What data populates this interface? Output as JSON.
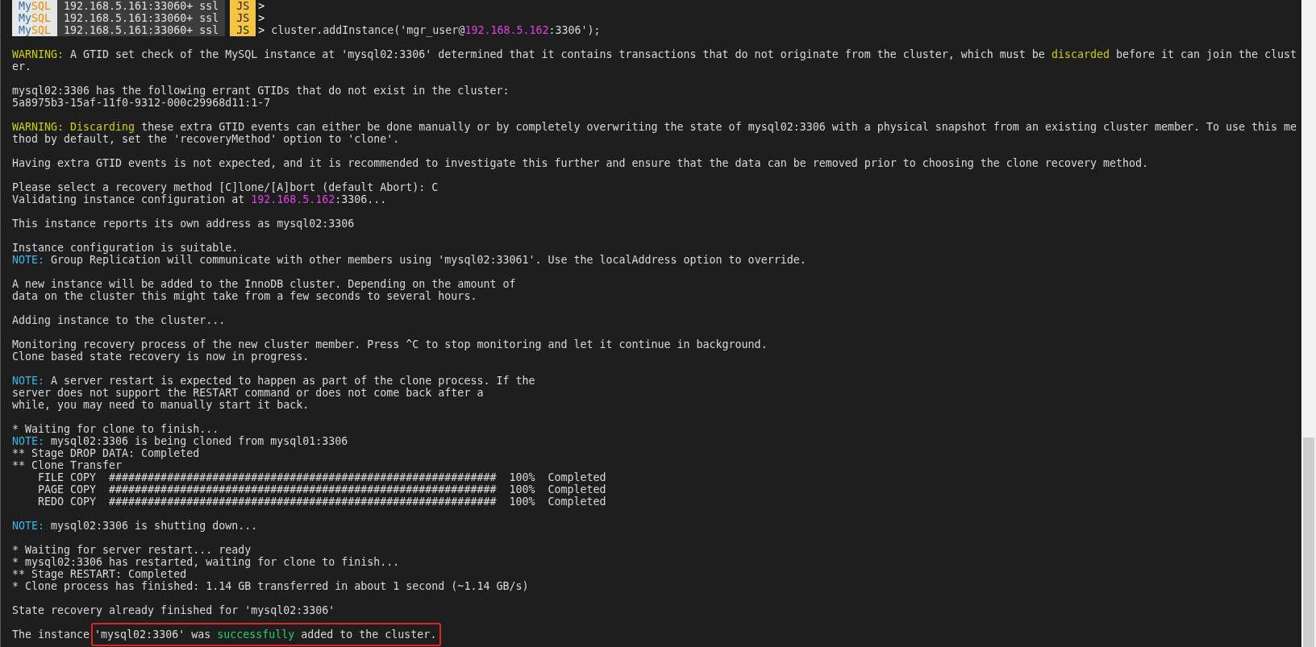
{
  "lines": [
    {
      "kind": "prompt",
      "badge": [
        {
          "text": "My",
          "color": "#2f6f9f"
        },
        {
          "text": "SQL",
          "color": "#e48e00"
        }
      ],
      "connection": "192.168.5.161:33060+ ssl",
      "mode": "JS",
      "arrow": ">"
    },
    {
      "kind": "prompt",
      "badge": [
        {
          "text": "My",
          "color": "#2f6f9f"
        },
        {
          "text": "SQL",
          "color": "#e48e00"
        }
      ],
      "connection": "192.168.5.161:33060+ ssl",
      "mode": "JS",
      "arrow": ">"
    },
    {
      "kind": "prompt",
      "badge": [
        {
          "text": "My",
          "color": "#2f6f9f"
        },
        {
          "text": "SQL",
          "color": "#e48e00"
        }
      ],
      "connection": "192.168.5.161:33060+ ssl",
      "mode": "JS",
      "arrow": ">",
      "command": [
        {
          "text": "cluster.addInstance('mgr_user@"
        },
        {
          "text": "192.168.5.162",
          "color": "#e040e0"
        },
        {
          "text": ":3306');"
        }
      ]
    },
    {
      "kind": "blank"
    },
    {
      "kind": "text",
      "segments": [
        {
          "text": "WARNING:",
          "color": "#cccc1a"
        },
        {
          "text": " A GTID set check of the MySQL instance at 'mysql02:3306' determined that it contains transactions that do not originate from the cluster, which must be "
        },
        {
          "text": "discarded",
          "color": "#cccc1a"
        },
        {
          "text": " before it can join the clust"
        }
      ]
    },
    {
      "kind": "text",
      "segments": [
        {
          "text": "er."
        }
      ]
    },
    {
      "kind": "blank"
    },
    {
      "kind": "text",
      "segments": [
        {
          "text": "mysql02:3306 has the following errant GTIDs that do not exist in the cluster:"
        }
      ]
    },
    {
      "kind": "text",
      "segments": [
        {
          "text": "5a8975b3-15af-11f0-9312-000c29968d11:1-7"
        }
      ]
    },
    {
      "kind": "blank"
    },
    {
      "kind": "text",
      "segments": [
        {
          "text": "WARNING: ",
          "color": "#cccc1a"
        },
        {
          "text": "Discarding",
          "color": "#cccc1a"
        },
        {
          "text": " these extra GTID events can either be done manually or by completely overwriting the state of mysql02:3306 with a physical snapshot from an existing cluster member. To use this me"
        }
      ]
    },
    {
      "kind": "text",
      "segments": [
        {
          "text": "thod by default, set the 'recoveryMethod' option to 'clone'."
        }
      ]
    },
    {
      "kind": "blank"
    },
    {
      "kind": "text",
      "segments": [
        {
          "text": "Having extra GTID events is not expected, and it is recommended to investigate this further and ensure that the data can be removed prior to choosing the clone recovery method."
        }
      ]
    },
    {
      "kind": "blank"
    },
    {
      "kind": "text",
      "segments": [
        {
          "text": "Please select a recovery method [C]lone/[A]bort (default Abort): C"
        }
      ]
    },
    {
      "kind": "text",
      "segments": [
        {
          "text": "Validating instance configuration at "
        },
        {
          "text": "192.168.5.162",
          "color": "#e040e0"
        },
        {
          "text": ":3306..."
        }
      ]
    },
    {
      "kind": "blank"
    },
    {
      "kind": "text",
      "segments": [
        {
          "text": "This instance reports its own address as mysql02:3306"
        }
      ]
    },
    {
      "kind": "blank"
    },
    {
      "kind": "text",
      "segments": [
        {
          "text": "Instance configuration is suitable."
        }
      ]
    },
    {
      "kind": "text",
      "segments": [
        {
          "text": "NOTE:",
          "color": "#3cb4e6"
        },
        {
          "text": " Group Replication will communicate with other members using 'mysql02:33061'. Use the localAddress option to override."
        }
      ]
    },
    {
      "kind": "blank"
    },
    {
      "kind": "text",
      "segments": [
        {
          "text": "A new instance will be added to the InnoDB cluster. Depending on the amount of"
        }
      ]
    },
    {
      "kind": "text",
      "segments": [
        {
          "text": "data on the cluster this might take from a few seconds to several hours."
        }
      ]
    },
    {
      "kind": "blank"
    },
    {
      "kind": "text",
      "segments": [
        {
          "text": "Adding instance to the cluster..."
        }
      ]
    },
    {
      "kind": "blank"
    },
    {
      "kind": "text",
      "segments": [
        {
          "text": "Monitoring recovery process of the new cluster member. Press ^C to stop monitoring and let it continue in background."
        }
      ]
    },
    {
      "kind": "text",
      "segments": [
        {
          "text": "Clone based state recovery is now in progress."
        }
      ]
    },
    {
      "kind": "blank"
    },
    {
      "kind": "text",
      "segments": [
        {
          "text": "NOTE:",
          "color": "#3cb4e6"
        },
        {
          "text": " A server restart is expected to happen as part of the clone process. If the"
        }
      ]
    },
    {
      "kind": "text",
      "segments": [
        {
          "text": "server does not support the RESTART command or does not come back after a"
        }
      ]
    },
    {
      "kind": "text",
      "segments": [
        {
          "text": "while, you may need to manually start it back."
        }
      ]
    },
    {
      "kind": "blank"
    },
    {
      "kind": "text",
      "segments": [
        {
          "text": "* Waiting for clone to finish..."
        }
      ]
    },
    {
      "kind": "text",
      "segments": [
        {
          "text": "NOTE:",
          "color": "#3cb4e6"
        },
        {
          "text": " mysql02:3306 is being cloned from mysql01:3306"
        }
      ]
    },
    {
      "kind": "text",
      "segments": [
        {
          "text": "** Stage DROP DATA: Completed"
        }
      ]
    },
    {
      "kind": "text",
      "segments": [
        {
          "text": "** Clone Transfer"
        }
      ]
    },
    {
      "kind": "text",
      "segments": [
        {
          "text": "    FILE COPY  ############################################################  100%  Completed"
        }
      ]
    },
    {
      "kind": "text",
      "segments": [
        {
          "text": "    PAGE COPY  ############################################################  100%  Completed"
        }
      ]
    },
    {
      "kind": "text",
      "segments": [
        {
          "text": "    REDO COPY  ############################################################  100%  Completed"
        }
      ]
    },
    {
      "kind": "blank"
    },
    {
      "kind": "text",
      "segments": [
        {
          "text": "NOTE:",
          "color": "#3cb4e6"
        },
        {
          "text": " mysql02:3306 is shutting down..."
        }
      ]
    },
    {
      "kind": "blank"
    },
    {
      "kind": "text",
      "segments": [
        {
          "text": "* Waiting for server restart... ready"
        }
      ]
    },
    {
      "kind": "text",
      "segments": [
        {
          "text": "* mysql02:3306 has restarted, waiting for clone to finish..."
        }
      ]
    },
    {
      "kind": "text",
      "segments": [
        {
          "text": "** Stage RESTART: Completed"
        }
      ]
    },
    {
      "kind": "text",
      "segments": [
        {
          "text": "* Clone process has finished: 1.14 GB transferred in about 1 second (~1.14 GB/s)"
        }
      ]
    },
    {
      "kind": "blank"
    },
    {
      "kind": "text",
      "segments": [
        {
          "text": "State recovery already finished for 'mysql02:3306'"
        }
      ]
    },
    {
      "kind": "blank"
    },
    {
      "kind": "text",
      "segments": [
        {
          "text": "The instance "
        }
      ],
      "boxed": [
        {
          "text": "'mysql02:3306' was "
        },
        {
          "text": "successfully",
          "color": "#2ecc71"
        },
        {
          "text": " added to the cluster."
        }
      ]
    }
  ]
}
